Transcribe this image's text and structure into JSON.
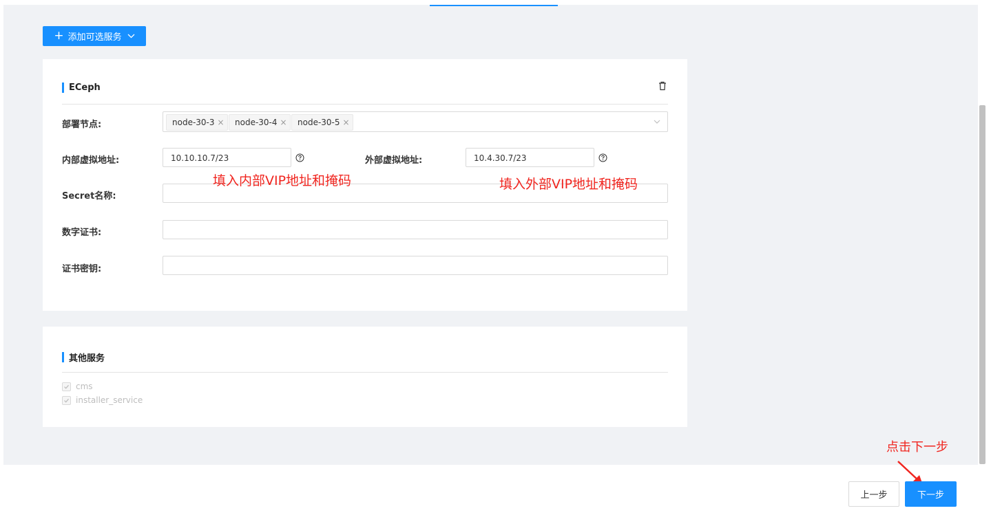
{
  "header": {
    "add_service_label": "添加可选服务"
  },
  "eceph_card": {
    "title": "ECeph",
    "fields": {
      "deploy_nodes": {
        "label": "部署节点:",
        "tags": [
          "node-30-3",
          "node-30-4",
          "node-30-5"
        ]
      },
      "internal_vip": {
        "label": "内部虚拟地址:",
        "value": "10.10.10.7/23"
      },
      "external_vip": {
        "label": "外部虚拟地址:",
        "value": "10.4.30.7/23"
      },
      "secret_name": {
        "label": "Secret名称:",
        "value": ""
      },
      "certificate": {
        "label": "数字证书:",
        "value": ""
      },
      "cert_key": {
        "label": "证书密钥:",
        "value": ""
      }
    }
  },
  "other_card": {
    "title": "其他服务",
    "services": [
      "cms",
      "installer_service"
    ]
  },
  "annotations": {
    "internal": "填入内部VIP地址和掩码",
    "external": "填入外部VIP地址和掩码",
    "next": "点击下一步"
  },
  "footer": {
    "prev_label": "上一步",
    "next_label": "下一步"
  },
  "colors": {
    "primary": "#1890ff",
    "annotation": "#f0251f",
    "background": "#f0f2f5"
  }
}
